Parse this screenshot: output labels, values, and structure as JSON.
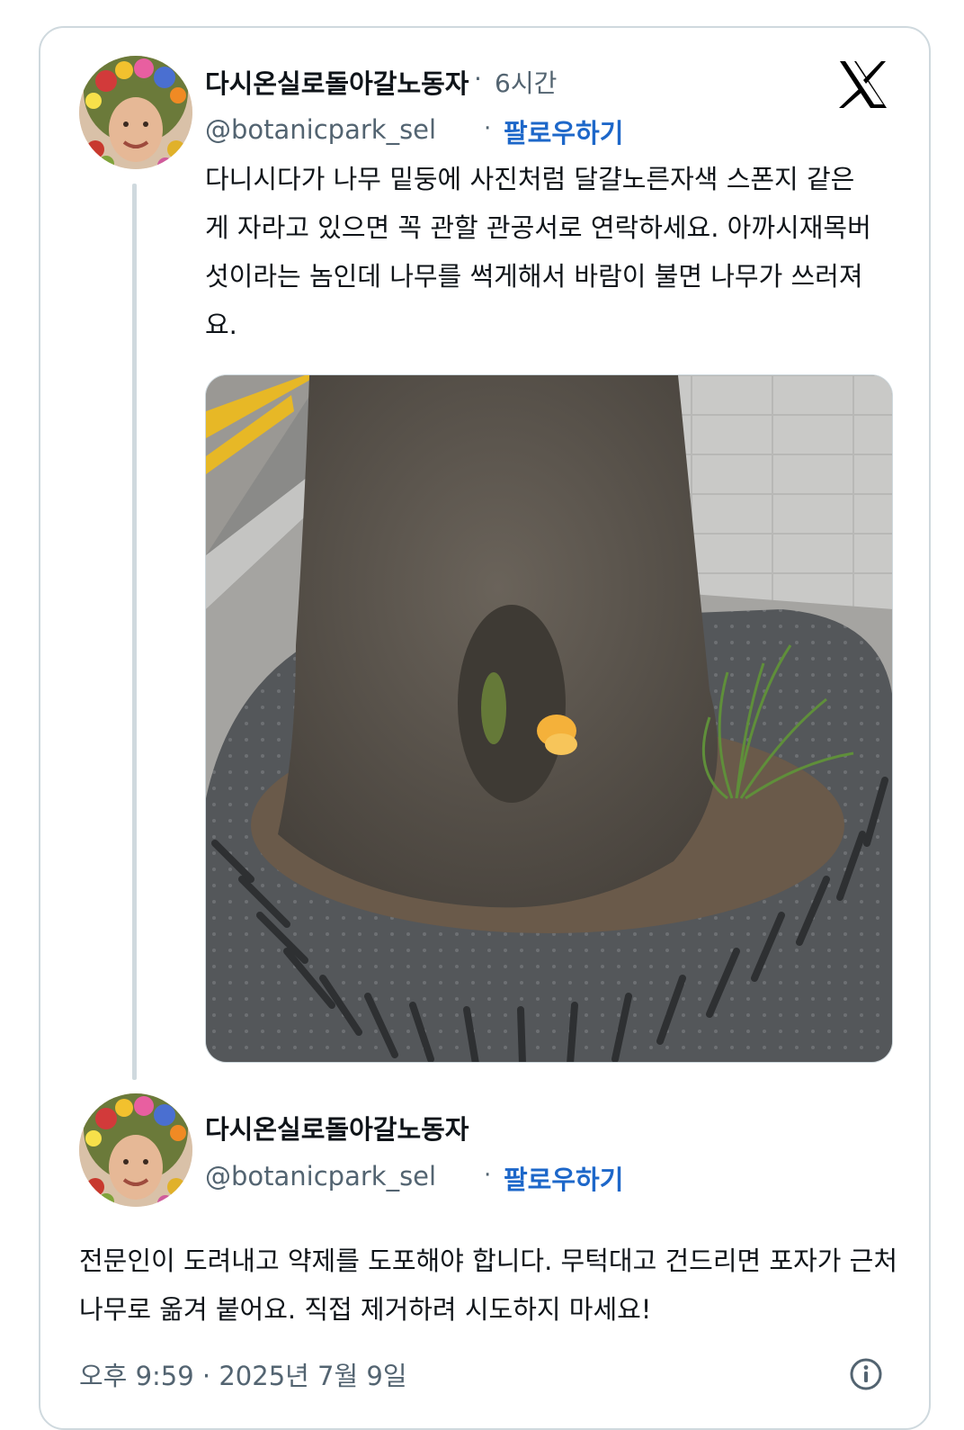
{
  "tweet1": {
    "display_name": "다시온실로돌아갈노동자",
    "time_sep": "·",
    "time": "6시간",
    "handle": "@botanicpark_sel",
    "follow_sep": "·",
    "follow_label": "팔로우하기",
    "text_lines": [
      "다니시다가 나무 밑둥에 사진처럼 달걀노른자색 스폰지 같은",
      "게 자라고 있으면 꼭 관할 관공서로 연락하세요. 아까시재목버",
      "섯이라는 놈인데 나무를 썩게해서 바람이 불면 나무가 쓰러져",
      "요."
    ]
  },
  "tweet2": {
    "display_name": "다시온실로돌아갈노동자",
    "handle": "@botanicpark_sel",
    "follow_sep": "·",
    "follow_label": "팔로우하기",
    "text_lines": [
      "전문인이 도려내고 약제를 도포해야 합니다. 무턱대고 건드리면 포자가 근처",
      "나무로 옮겨 붙어요. 직접 제거하려 시도하지 마세요!"
    ]
  },
  "footer": {
    "timestamp": "오후 9:59 · 2025년 7월 9일"
  },
  "icons": {
    "brand": "x-logo-icon",
    "info": "info-icon"
  },
  "colors": {
    "follow": "#1d67c9",
    "secondary_text": "#536471",
    "border": "#cfd9de"
  }
}
